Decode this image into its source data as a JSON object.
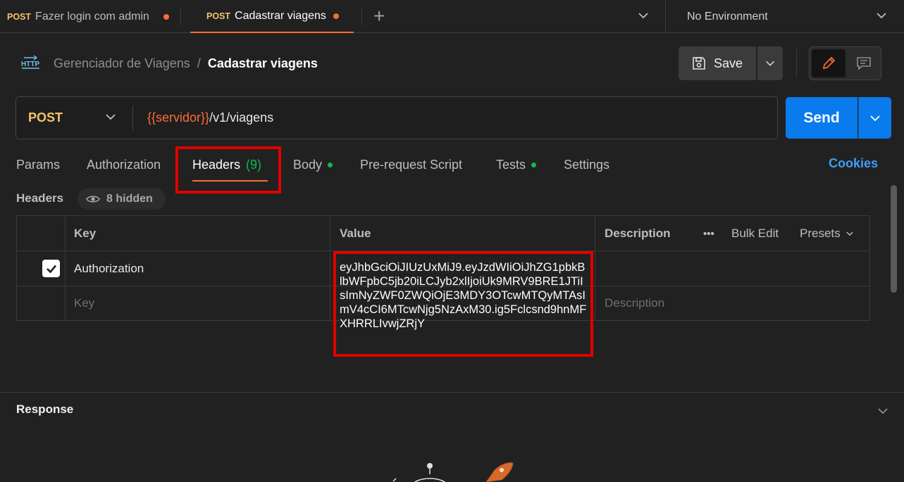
{
  "tabs": [
    {
      "method": "POST",
      "title": "Fazer login com admin"
    },
    {
      "method": "POST",
      "title": "Cadastrar viagens"
    }
  ],
  "environment": {
    "label": "No Environment"
  },
  "breadcrumb": {
    "parent": "Gerenciador de Viagens",
    "separator": "/",
    "current": "Cadastrar viagens"
  },
  "toolbar": {
    "save_label": "Save"
  },
  "request": {
    "method": "POST",
    "url_variable": "{{servidor}}",
    "url_path": "/v1/viagens",
    "send_label": "Send"
  },
  "request_tabs": {
    "params": "Params",
    "authorization": "Authorization",
    "headers": "Headers",
    "headers_count": "(9)",
    "body": "Body",
    "prerequest": "Pre-request Script",
    "tests": "Tests",
    "settings": "Settings",
    "cookies": "Cookies"
  },
  "headers_section": {
    "label": "Headers",
    "hidden_label": "8 hidden"
  },
  "table": {
    "columns": {
      "key": "Key",
      "value": "Value",
      "description": "Description"
    },
    "more_label": "•••",
    "bulk_edit": "Bulk Edit",
    "presets": "Presets",
    "rows": [
      {
        "checked": true,
        "key": "Authorization",
        "value": "eyJhbGciOiJIUzUxMiJ9.eyJzdWIiOiJhZG1pbkBlbWFpbC5jb20iLCJyb2xlIjoiUk9MRV9BRE1JTiIsImNyZWF0ZWQiOjE3MDY3OTcwMTQyMTAsImV4cCI6MTcwNjg5NzAxM30.ig5Fclcsnd9hnMFXHRRLIvwjZRjY",
        "description": ""
      }
    ],
    "placeholders": {
      "key": "Key",
      "description": "Description"
    }
  },
  "response": {
    "title": "Response"
  },
  "colors": {
    "accent": "#ff6c37",
    "send": "#097bed",
    "highlight": "#e00000",
    "green": "#0cbb52",
    "method": "#f5c26b"
  }
}
